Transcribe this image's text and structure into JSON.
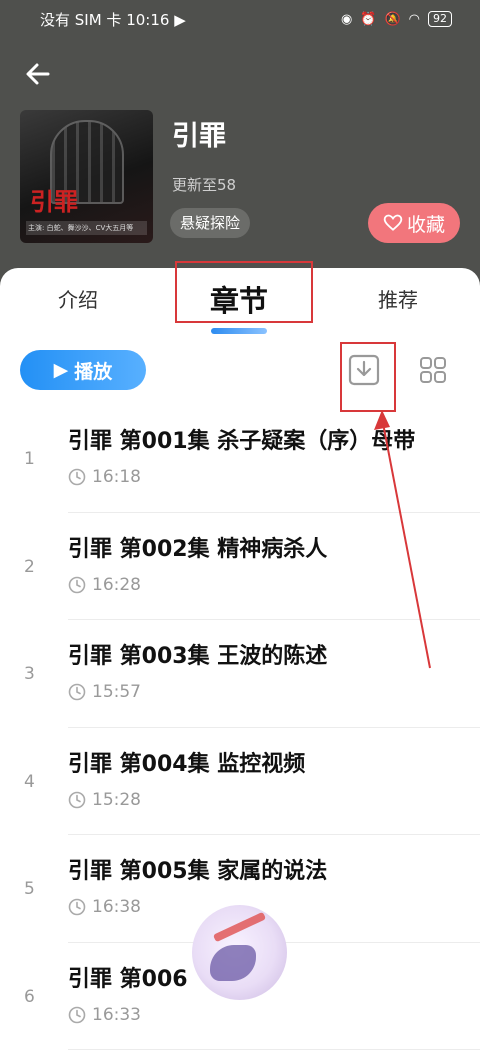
{
  "status": {
    "carrier": "没有 SIM 卡",
    "time": "10:16",
    "battery": "92"
  },
  "book": {
    "title": "引罪",
    "cover_title": "引罪",
    "cover_subtitle": "主演: 白蛇、舞沙沙、CV大五月等",
    "update": "更新至58",
    "tag": "悬疑探险",
    "favorite_label": "收藏"
  },
  "tabs": [
    {
      "label": "介绍"
    },
    {
      "label": "章节"
    },
    {
      "label": "推荐"
    }
  ],
  "toolbar": {
    "play_label": "播放"
  },
  "chapters": [
    {
      "num": "1",
      "title": "引罪  第001集  杀子疑案（序）母带",
      "time": "16:18"
    },
    {
      "num": "2",
      "title": "引罪  第002集  精神病杀人",
      "time": "16:28"
    },
    {
      "num": "3",
      "title": "引罪  第003集  王波的陈述",
      "time": "15:57"
    },
    {
      "num": "4",
      "title": "引罪  第004集  监控视频",
      "time": "15:28"
    },
    {
      "num": "5",
      "title": "引罪  第005集  家属的说法",
      "time": "16:38"
    },
    {
      "num": "6",
      "title": "引罪  第006",
      "time": "16:33"
    }
  ],
  "colors": {
    "header_bg": "#4f504d",
    "accent_blue": "#2390f5",
    "favorite_pink": "#f2767c",
    "annotation_red": "#d8383a"
  }
}
